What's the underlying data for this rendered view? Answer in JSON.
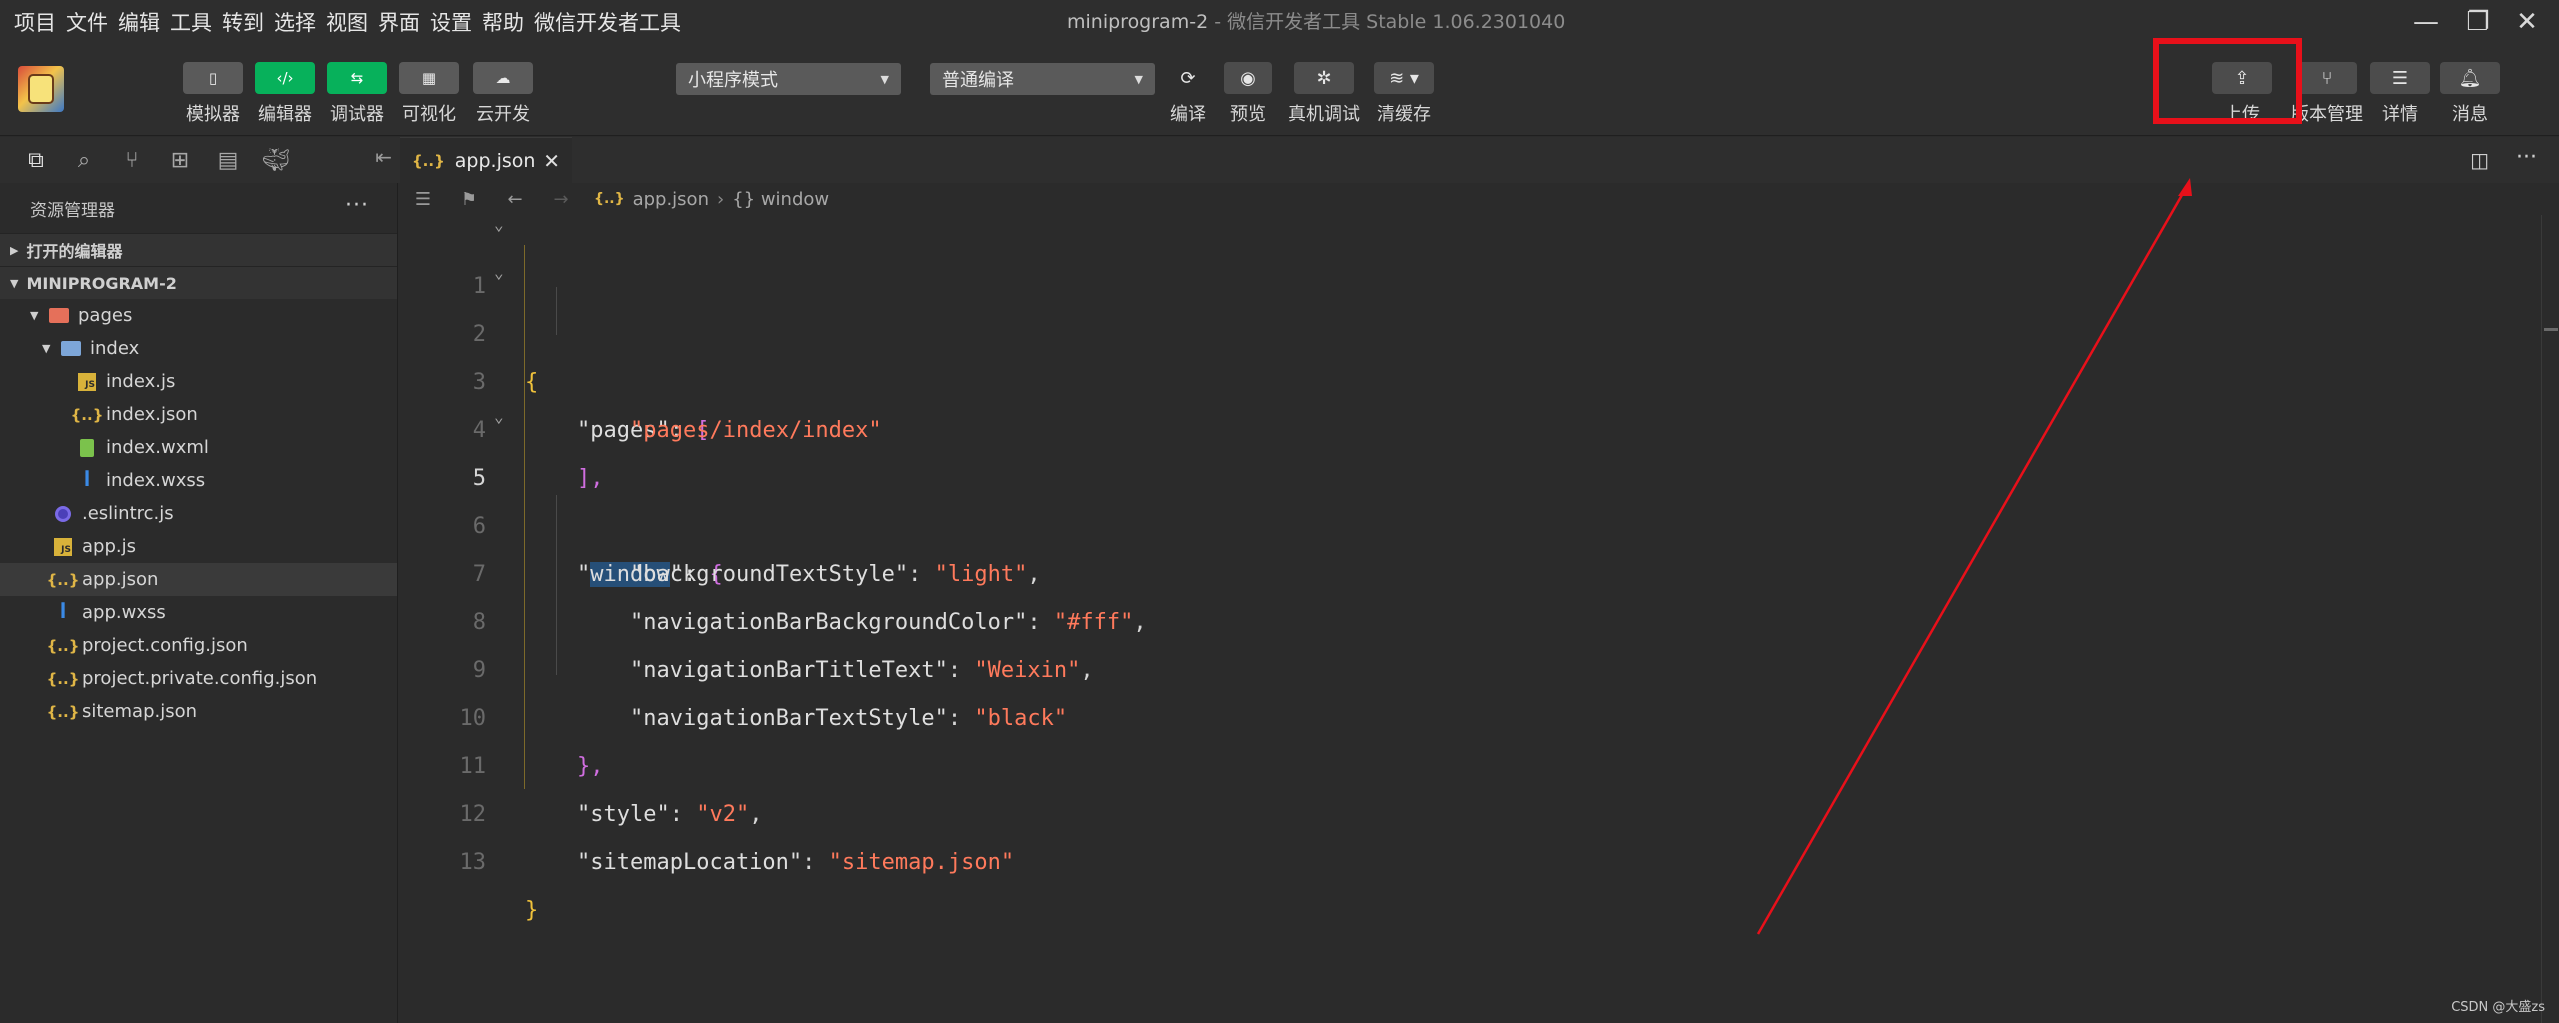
{
  "menu": [
    "项目",
    "文件",
    "编辑",
    "工具",
    "转到",
    "选择",
    "视图",
    "界面",
    "设置",
    "帮助",
    "微信开发者工具"
  ],
  "window_title": {
    "project": "miniprogram-2",
    "separator": " - ",
    "app": "微信开发者工具 Stable 1.06.2301040"
  },
  "toolbar": {
    "left_buttons": [
      {
        "label": "模拟器",
        "icon": "phone-icon"
      },
      {
        "label": "编辑器",
        "icon": "code-icon"
      },
      {
        "label": "调试器",
        "icon": "debug-icon"
      },
      {
        "label": "可视化",
        "icon": "layout-icon"
      },
      {
        "label": "云开发",
        "icon": "cloud-icon"
      }
    ],
    "mode_select": "小程序模式",
    "compile_select": "普通编译",
    "center_buttons": [
      {
        "label": "编译",
        "icon": "refresh-icon"
      },
      {
        "label": "预览",
        "icon": "eye-icon"
      },
      {
        "label": "真机调试",
        "icon": "bug-icon"
      },
      {
        "label": "清缓存",
        "icon": "layers-icon"
      }
    ],
    "right_buttons": [
      {
        "label": "上传",
        "icon": "upload-icon"
      },
      {
        "label": "版本管理",
        "icon": "branch-icon"
      },
      {
        "label": "详情",
        "icon": "menu-icon"
      },
      {
        "label": "消息",
        "icon": "bell-icon"
      }
    ]
  },
  "sidebar": {
    "header": "资源管理器",
    "more": "···",
    "open_editors": "打开的编辑器",
    "project": "MINIPROGRAM-2",
    "tree": [
      {
        "name": "pages",
        "type": "folder"
      },
      {
        "name": "index",
        "type": "folder-open"
      },
      {
        "name": "index.js",
        "type": "js"
      },
      {
        "name": "index.json",
        "type": "json"
      },
      {
        "name": "index.wxml",
        "type": "wxml"
      },
      {
        "name": "index.wxss",
        "type": "wxss"
      },
      {
        "name": ".eslintrc.js",
        "type": "eslint"
      },
      {
        "name": "app.js",
        "type": "js"
      },
      {
        "name": "app.json",
        "type": "json"
      },
      {
        "name": "app.wxss",
        "type": "wxss"
      },
      {
        "name": "project.config.json",
        "type": "json"
      },
      {
        "name": "project.private.config.json",
        "type": "json"
      },
      {
        "name": "sitemap.json",
        "type": "json"
      }
    ]
  },
  "editor": {
    "tab": "app.json",
    "breadcrumb_file": "app.json",
    "breadcrumb_symbol": "{} window",
    "current_line": 5,
    "line_numbers": [
      "1",
      "2",
      "3",
      "4",
      "5",
      "6",
      "7",
      "8",
      "9",
      "10",
      "11",
      "12",
      "13"
    ],
    "code": {
      "l1": "{",
      "l2_key": "\"pages\"",
      "l2_bracket": "[",
      "l3_val": "\"pages/index/index\"",
      "l4": "],",
      "l5_q": "\"",
      "l5_key": "window",
      "l5_tail": "\": ",
      "l5_brace": "{",
      "l6_key": "\"backgroundTextStyle\"",
      "l6_val": "\"light\"",
      "l7_key": "\"navigationBarBackgroundColor\"",
      "l7_val": "\"#fff\"",
      "l8_key": "\"navigationBarTitleText\"",
      "l8_val": "\"Weixin\"",
      "l9_key": "\"navigationBarTextStyle\"",
      "l9_val": "\"black\"",
      "l10": "},",
      "l11_key": "\"style\"",
      "l11_val": "\"v2\"",
      "l12_key": "\"sitemapLocation\"",
      "l12_val": "\"sitemap.json\"",
      "l13": "}"
    }
  },
  "watermark": "CSDN @大盛zs",
  "colors": {
    "accent_green": "#07b15b",
    "annotation_red": "#e8101a",
    "string": "#ff7a5c",
    "background": "#2b2b2b"
  }
}
